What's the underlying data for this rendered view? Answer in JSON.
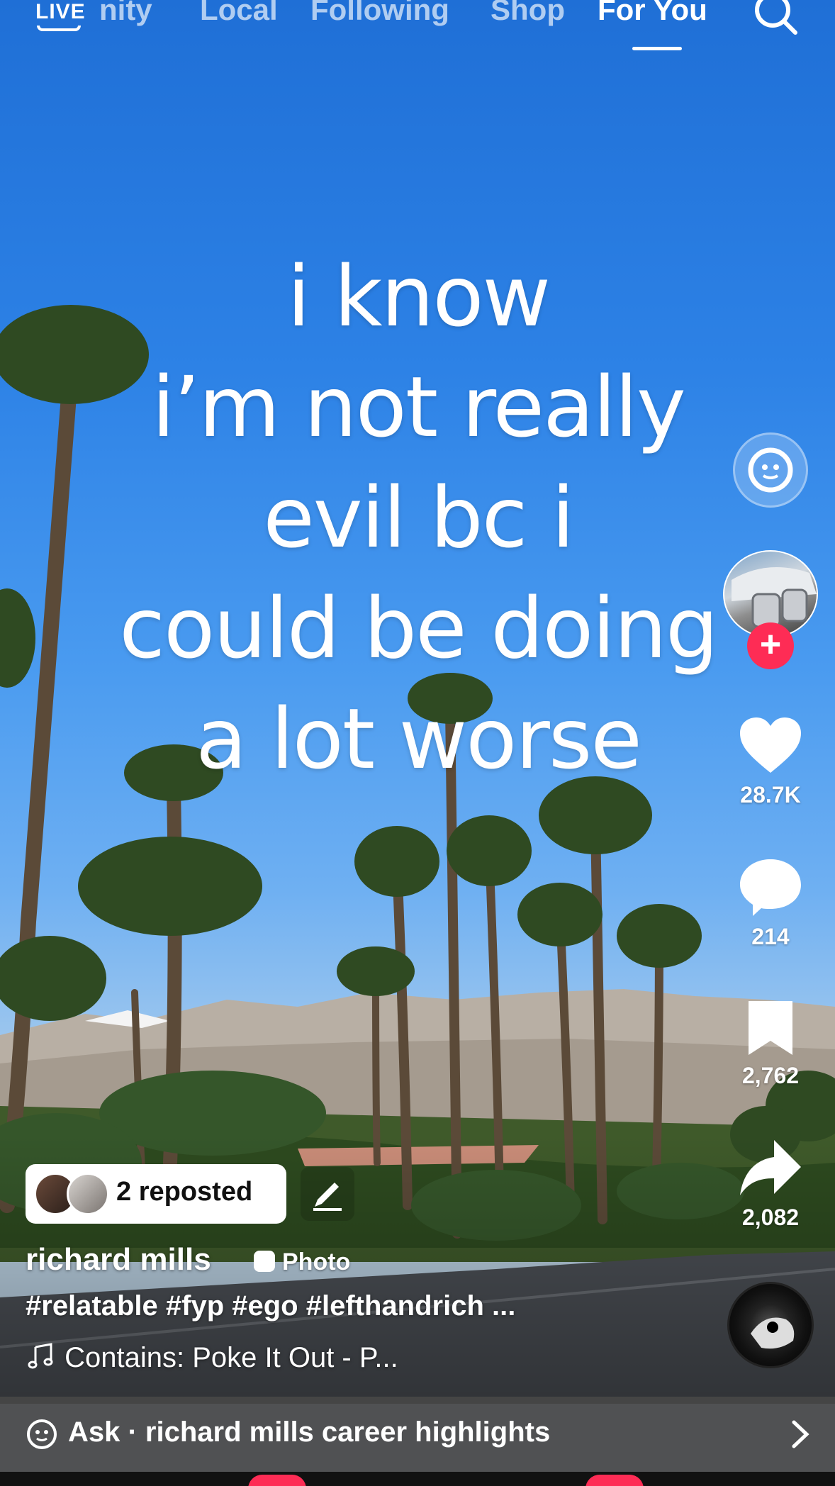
{
  "top_nav": {
    "live_label": "LIVE",
    "tabs": [
      {
        "label": "nity"
      },
      {
        "label": "Local"
      },
      {
        "label": "Following"
      },
      {
        "label": "Shop"
      },
      {
        "label": "For You"
      }
    ],
    "active_tab": "For You"
  },
  "caption_lines": [
    "i know",
    "i’m not really",
    "evil bc i",
    "could be doing",
    "a lot worse"
  ],
  "rail": {
    "likes": "28.7K",
    "comments": "214",
    "saves": "2,762",
    "shares": "2,082"
  },
  "post": {
    "repost_label": "2 reposted",
    "author": "richard mills",
    "media_type": "Photo",
    "hashtags": "#relatable #fyp #ego #lefthandrich ...",
    "music": "Contains: Poke It Out - P..."
  },
  "ask_bar": {
    "label": "Ask · richard mills career highlights"
  },
  "colors": {
    "accent": "#fe2c55",
    "sky_top": "#1f6fd6"
  }
}
